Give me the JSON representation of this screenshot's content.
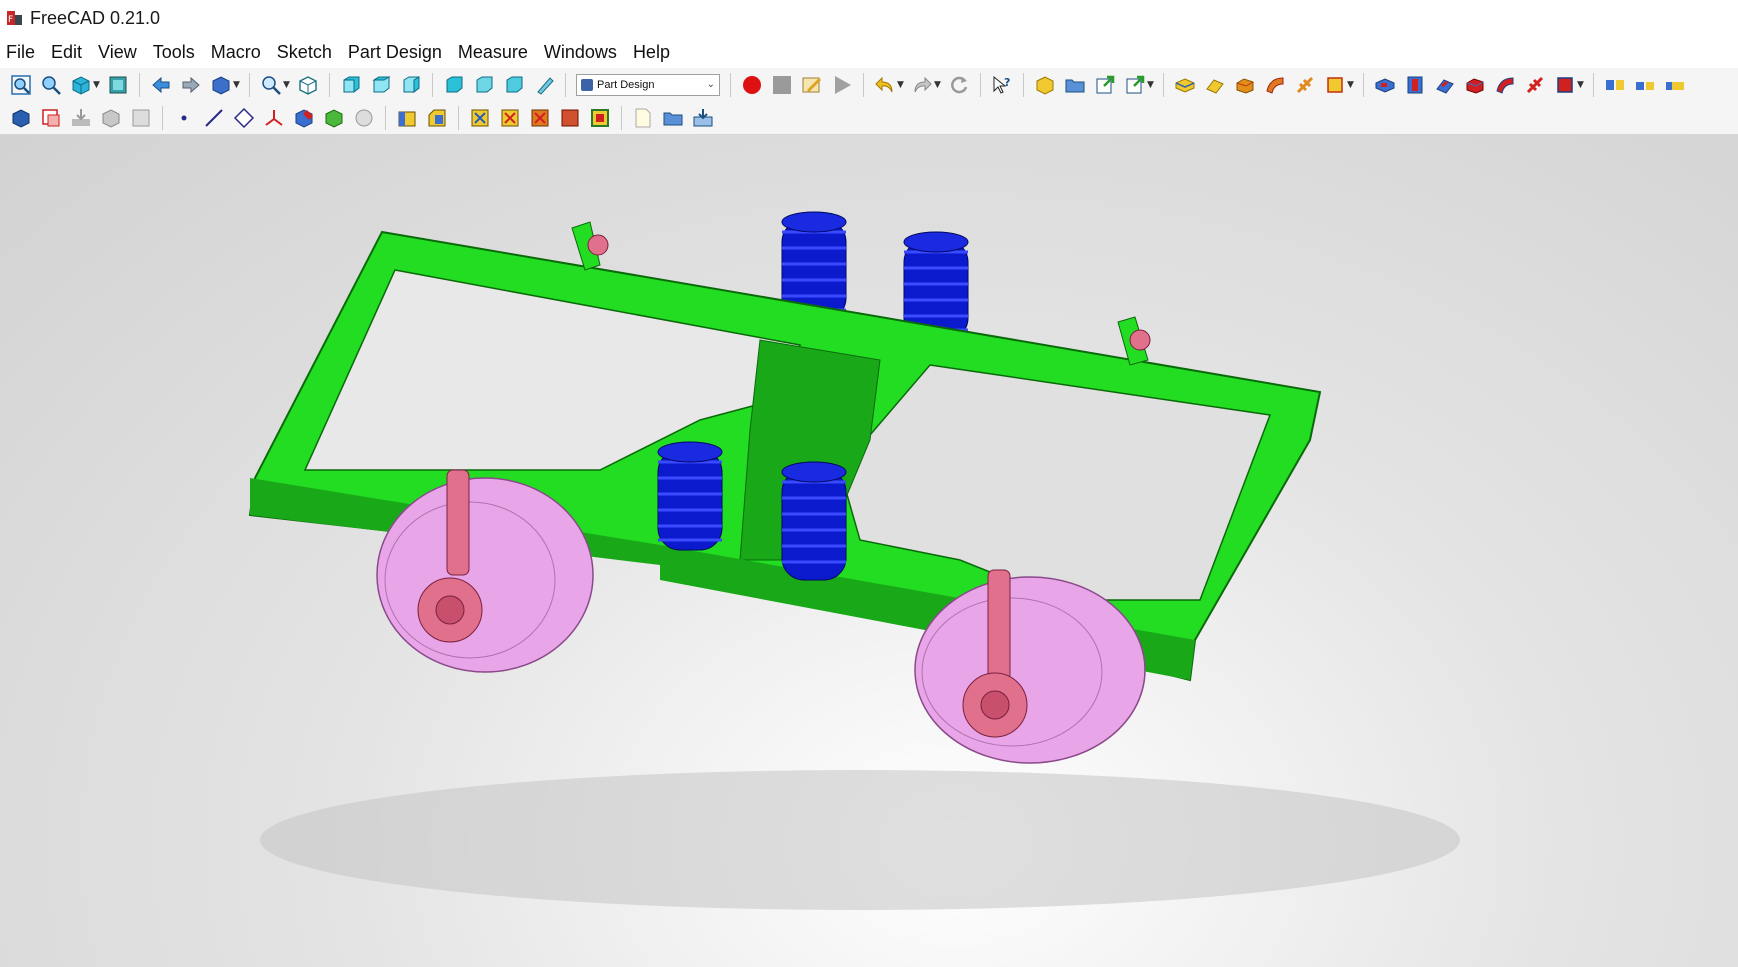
{
  "window": {
    "title": "FreeCAD 0.21.0"
  },
  "menu": [
    {
      "label": "File"
    },
    {
      "label": "Edit"
    },
    {
      "label": "View"
    },
    {
      "label": "Tools"
    },
    {
      "label": "Macro"
    },
    {
      "label": "Sketch"
    },
    {
      "label": "Part Design"
    },
    {
      "label": "Measure"
    },
    {
      "label": "Windows"
    },
    {
      "label": "Help"
    }
  ],
  "toolbar": {
    "workbench_selector": {
      "value": "Part Design"
    }
  },
  "colors": {
    "frame": "#22dd22",
    "frame_dark": "#18a818",
    "springs": "#0a1acc",
    "wheels": "#e8a6e8",
    "motors": "#e01010",
    "motors_dark": "#8a0a0a",
    "axle_boxes": "#e0708c",
    "record": "#dd1111"
  }
}
